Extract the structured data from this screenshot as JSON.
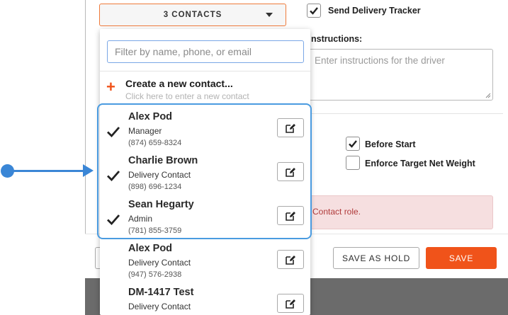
{
  "contacts_dropdown": {
    "trigger_label": "3 CONTACTS",
    "filter_placeholder": "Filter by name, phone, or email",
    "create_title": "Create a new contact...",
    "create_hint": "Click here to enter a new contact",
    "contacts": [
      {
        "name": "Alex Pod",
        "role": "Manager",
        "phone": "(874) 659-8324",
        "selected": true
      },
      {
        "name": "Charlie Brown",
        "role": "Delivery Contact",
        "phone": "(898) 696-1234",
        "selected": true
      },
      {
        "name": "Sean Hegarty",
        "role": "Admin",
        "phone": "(781) 855-3759",
        "selected": true
      },
      {
        "name": "Alex Pod",
        "role": "Delivery Contact",
        "phone": "(947) 576-2938",
        "selected": false
      },
      {
        "name": "DM-1417 Test",
        "role": "Delivery Contact",
        "phone": "",
        "selected": false
      }
    ]
  },
  "form": {
    "send_tracker_label": "Send Delivery Tracker",
    "send_tracker_checked": true,
    "instructions_label": "nstructions:",
    "instructions_placeholder": "Enter instructions for the driver",
    "before_start_label": "Before Start",
    "before_start_checked": true,
    "enforce_weight_label": "Enforce Target Net Weight",
    "enforce_weight_checked": false,
    "error_text": "Contact role."
  },
  "footer": {
    "save_hold_label": "SAVE AS HOLD",
    "save_label": "SAVE"
  },
  "colors": {
    "accent_orange": "#f0531a",
    "highlight_blue": "#4a9be0",
    "error_bg": "#f6dfe0"
  },
  "icons": {
    "check": "check-icon",
    "edit": "edit-icon",
    "plus": "plus-icon",
    "caret": "chevron-down-icon"
  }
}
